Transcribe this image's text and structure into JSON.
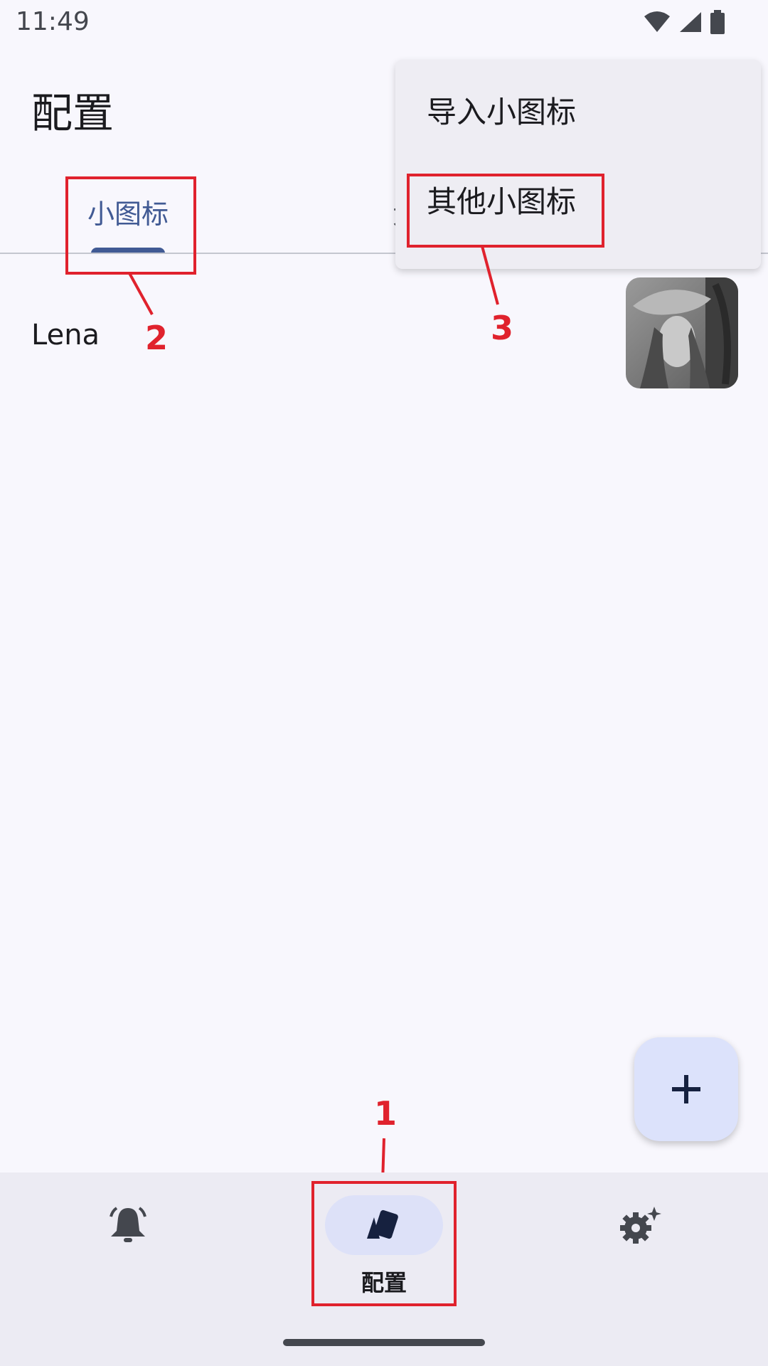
{
  "status_bar": {
    "time": "11:49",
    "icons": [
      "wifi-icon",
      "signal-icon",
      "battery-icon"
    ]
  },
  "app_bar": {
    "title": "配置"
  },
  "tabs": [
    {
      "label": "小图标",
      "selected": true
    },
    {
      "label": "大图",
      "selected": false
    }
  ],
  "list": [
    {
      "label": "Lena",
      "thumbnail": "lena-thumbnail"
    }
  ],
  "menu": {
    "items": [
      {
        "label": "导入小图标"
      },
      {
        "label": "其他小图标"
      }
    ]
  },
  "fab": {
    "icon": "plus-icon"
  },
  "bottom_nav": {
    "items": [
      {
        "icon": "bell-icon",
        "label": ""
      },
      {
        "icon": "cards-icon",
        "label": "配置",
        "selected": true
      },
      {
        "icon": "gear-sparkle-icon",
        "label": ""
      }
    ]
  },
  "annotations": [
    "1",
    "2",
    "3"
  ],
  "colors": {
    "background": "#f8f7fd",
    "accent": "#415a94",
    "annotation": "#e0222d",
    "nav_background": "#ecebf3",
    "fab_background": "#dce2fb"
  }
}
